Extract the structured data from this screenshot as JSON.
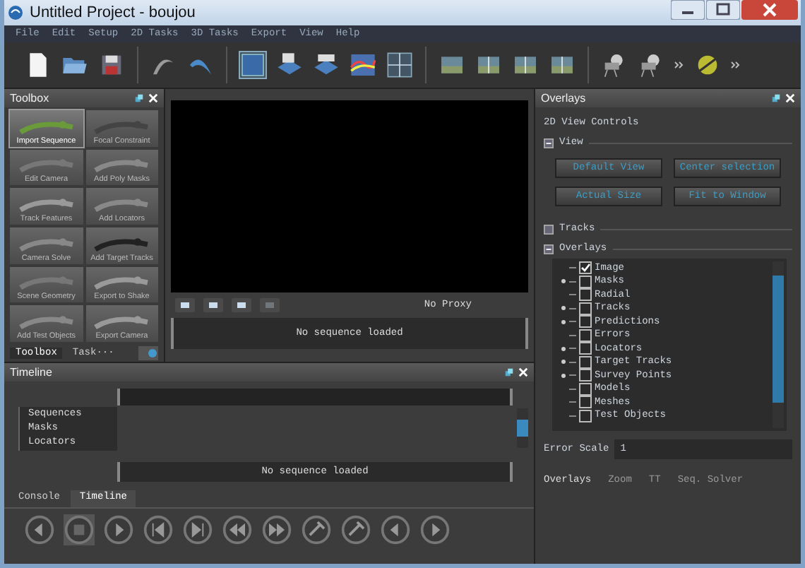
{
  "window": {
    "title": "Untitled Project - boujou"
  },
  "menu": [
    "File",
    "Edit",
    "Setup",
    "2D Tasks",
    "3D Tasks",
    "Export",
    "View",
    "Help"
  ],
  "toolbox": {
    "title": "Toolbox",
    "tools": [
      {
        "label": "Import Sequence",
        "selected": true
      },
      {
        "label": "Focal Constraint",
        "selected": false
      },
      {
        "label": "Edit Camera",
        "selected": false
      },
      {
        "label": "Add Poly Masks",
        "selected": false
      },
      {
        "label": "Track Features",
        "selected": false
      },
      {
        "label": "Add Locators",
        "selected": false
      },
      {
        "label": "Camera Solve",
        "selected": false
      },
      {
        "label": "Add Target Tracks",
        "selected": false
      },
      {
        "label": "Scene Geometry",
        "selected": false
      },
      {
        "label": "Export to Shake",
        "selected": false
      },
      {
        "label": "Add Test Objects",
        "selected": false
      },
      {
        "label": "Export Camera",
        "selected": false
      }
    ],
    "tabs": [
      {
        "label": "Toolbox",
        "selected": true
      },
      {
        "label": "Task···",
        "selected": false
      }
    ]
  },
  "viewer": {
    "proxy": "No Proxy",
    "status": "No sequence loaded"
  },
  "timeline": {
    "title": "Timeline",
    "tracks": [
      "Sequences",
      "Masks",
      "Locators"
    ],
    "status": "No sequence loaded",
    "tabs": [
      {
        "label": "Console",
        "selected": false
      },
      {
        "label": "Timeline",
        "selected": true
      }
    ]
  },
  "overlays": {
    "title": "Overlays",
    "heading": "2D View Controls",
    "sections": [
      {
        "label": "View",
        "expanded": true,
        "buttons": [
          "Default View",
          "Center selection",
          "Actual Size",
          "Fit to Window"
        ]
      },
      {
        "label": "Tracks",
        "expanded": false
      },
      {
        "label": "Overlays",
        "expanded": true,
        "items": [
          {
            "label": "Image",
            "checked": true,
            "expandable": false
          },
          {
            "label": "Masks",
            "checked": false,
            "expandable": true
          },
          {
            "label": "Radial",
            "checked": false,
            "expandable": false
          },
          {
            "label": "Tracks",
            "checked": false,
            "expandable": true
          },
          {
            "label": "Predictions",
            "checked": false,
            "expandable": true
          },
          {
            "label": "Errors",
            "checked": false,
            "expandable": false
          },
          {
            "label": "Locators",
            "checked": false,
            "expandable": true
          },
          {
            "label": "Target Tracks",
            "checked": false,
            "expandable": true
          },
          {
            "label": "Survey Points",
            "checked": false,
            "expandable": true
          },
          {
            "label": "Models",
            "checked": false,
            "expandable": false
          },
          {
            "label": "Meshes",
            "checked": false,
            "expandable": false
          },
          {
            "label": "Test Objects",
            "checked": false,
            "expandable": false
          }
        ]
      }
    ],
    "error_scale": {
      "label": "Error Scale",
      "value": "1"
    },
    "tabs": [
      {
        "label": "Overlays",
        "selected": true
      },
      {
        "label": "Zoom",
        "selected": false
      },
      {
        "label": "TT",
        "selected": false
      },
      {
        "label": "Seq. Solver",
        "selected": false
      }
    ]
  }
}
